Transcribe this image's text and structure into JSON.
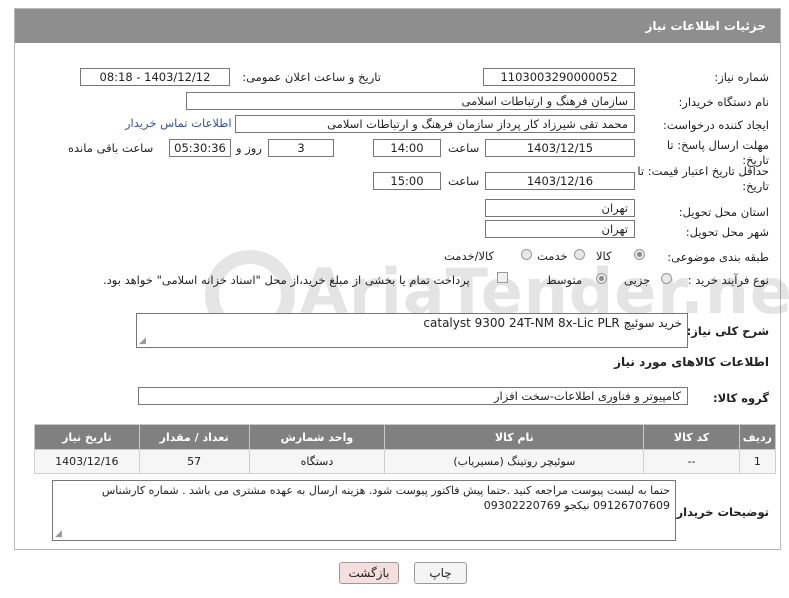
{
  "header": {
    "title": "جزئیات اطلاعات نیاز"
  },
  "fields": {
    "need_number_label": "شماره نیاز:",
    "need_number": "1103003290000052",
    "announce_label": "تاریخ و ساعت اعلان عمومی:",
    "announce_value": "1403/12/12 - 08:18",
    "buyer_org_label": "نام دستگاه خریدار:",
    "buyer_org": "سازمان فرهنگ و ارتباطات اسلامی",
    "requester_label": "ایجاد کننده درخواست:",
    "requester": "محمد تقی شیرزاد کار پرداز  سازمان فرهنگ و ارتباطات اسلامی",
    "contact_link": "اطلاعات تماس خریدار",
    "deadline_label": "مهلت ارسال پاسخ: تا تاریخ:",
    "deadline_date": "1403/12/15",
    "time_label": "ساعت",
    "deadline_time": "14:00",
    "days": "3",
    "days_label": "روز و",
    "remaining": "05:30:36",
    "remaining_label": "ساعت باقی مانده",
    "validity_label": "حداقل تاریخ اعتبار قیمت: تا تاریخ:",
    "validity_date": "1403/12/16",
    "validity_time": "15:00",
    "province_label": "استان محل تحویل:",
    "province": "تهران",
    "city_label": "شهر محل تحویل:",
    "city": "تهران",
    "category_label": "طبقه بندی موضوعی:",
    "category_options": [
      "کالا",
      "خدمت",
      "کالا/خدمت"
    ],
    "purchase_type_label": "نوع فرآیند خرید :",
    "purchase_options": [
      "جزیی",
      "متوسط"
    ],
    "payment_note": "پرداخت تمام یا بخشی از مبلغ خرید،از محل \"اسناد خزانه اسلامی\" خواهد بود."
  },
  "description": {
    "label": "شرح کلی نیاز:",
    "value": "خرید  سوئیچ  catalyst 9300 24T-NM 8x-Lic PLR"
  },
  "goods_section_title": "اطلاعات کالاهای مورد نیاز",
  "goods_group": {
    "label": "گروه کالا:",
    "value": "کامپیوتر و فناوری اطلاعات-سخت افزار"
  },
  "table": {
    "headers": [
      "ردیف",
      "کد کالا",
      "نام کالا",
      "واحد شمارش",
      "تعداد / مقدار",
      "تاریخ نیاز"
    ],
    "rows": [
      [
        "1",
        "--",
        "سوئیچر روتینگ (مسیریاب)",
        "دستگاه",
        "57",
        "1403/12/16"
      ]
    ]
  },
  "buyer_notes": {
    "label": "توضیحات خریدار:",
    "value": "حتما به لیست پیوست مراجعه کنید .حتما پیش فاکتور پیوست شود. هزینه ارسال به عهده مشتری می باشد . شماره کارشناس 09126707609 نیکجو 09302220769"
  },
  "buttons": {
    "print": "چاپ",
    "back": "بازگشت"
  },
  "watermark": "AriaTender.neT",
  "colors": {
    "header_bg": "#8e8e8e",
    "link": "#2a55b5",
    "back_btn_bg": "#f7dede"
  }
}
